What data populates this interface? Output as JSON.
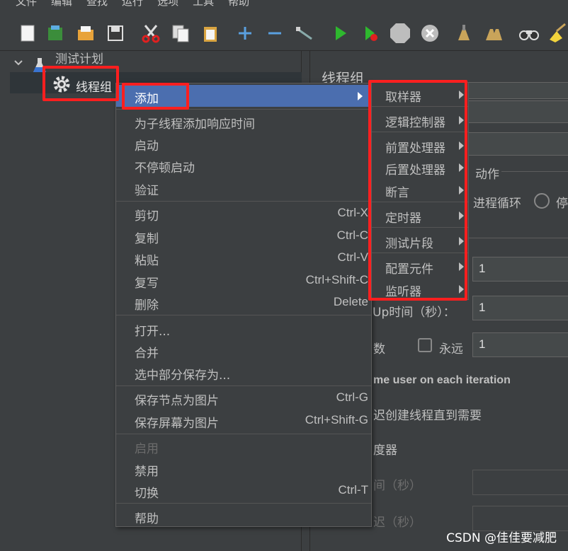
{
  "menubar": {
    "items": [
      "文件",
      "编辑",
      "查找",
      "运行",
      "选项",
      "工具",
      "帮助"
    ]
  },
  "toolbar": {
    "icons": [
      "new-icon",
      "templates-icon",
      "open-icon",
      "save-icon",
      "cut-icon",
      "copy-icon",
      "paste-icon",
      "expand-icon",
      "collapse-icon",
      "toggle-icon",
      "start-icon",
      "start-no-pause-icon",
      "stop-icon",
      "shutdown-icon",
      "clear-icon",
      "clear-all-icon",
      "search-icon",
      "reset-search-icon"
    ]
  },
  "tree": {
    "root": "测试计划",
    "child": "线程组"
  },
  "right": {
    "title": "线程组",
    "action_label": "动作",
    "radio_label": "进程循环",
    "radio_label2": "停",
    "field1_value": "1",
    "rampup_label": "Up时间（秒）：",
    "rampup_value": "1",
    "loop_label": "数",
    "forever_label": "永远",
    "loop_value": "1",
    "same_user_label": "me user on each iteration",
    "delay_label": "迟创建线程直到需要",
    "scheduler_label": "度器",
    "duration_label": "间（秒）",
    "startup_delay_label": "迟（秒）"
  },
  "context_menu": {
    "add": "添加",
    "add_think_time": "为子线程添加响应时间",
    "start": "启动",
    "start_no_pause": "不停顿启动",
    "validate": "验证",
    "cut": "剪切",
    "cut_sc": "Ctrl-X",
    "copy": "复制",
    "copy_sc": "Ctrl-C",
    "paste": "粘贴",
    "paste_sc": "Ctrl-V",
    "duplicate": "复写",
    "duplicate_sc": "Ctrl+Shift-C",
    "remove": "删除",
    "remove_sc": "Delete",
    "open": "打开...",
    "merge": "合并",
    "save_selection": "选中部分保存为...",
    "save_node_image": "保存节点为图片",
    "save_node_image_sc": "Ctrl-G",
    "save_screen_image": "保存屏幕为图片",
    "save_screen_image_sc": "Ctrl+Shift-G",
    "enable": "启用",
    "disable": "禁用",
    "toggle": "切换",
    "toggle_sc": "Ctrl-T",
    "help": "帮助"
  },
  "submenu": {
    "sampler": "取样器",
    "logic_controller": "逻辑控制器",
    "pre_processor": "前置处理器",
    "post_processor": "后置处理器",
    "assertion": "断言",
    "timer": "定时器",
    "test_fragment": "测试片段",
    "config_element": "配置元件",
    "listener": "监听器"
  },
  "colors": {
    "highlight": "#4b6eaf",
    "annotation": "#ff1f1f",
    "background": "#3c3f41"
  },
  "watermark": "CSDN @佳佳要减肥"
}
